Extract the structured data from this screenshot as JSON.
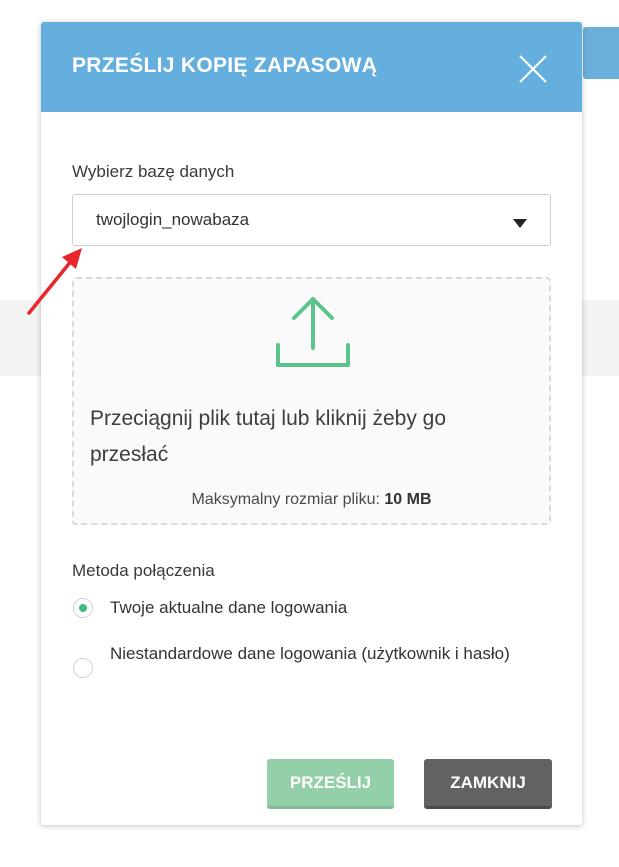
{
  "modal": {
    "title": "PRZEŚLIJ KOPIĘ ZAPASOWĄ",
    "close_icon": "close-x-icon"
  },
  "database": {
    "label": "Wybierz bazę danych",
    "selected": "twojlogin_nowabaza",
    "caret_icon": "caret-down-icon"
  },
  "upload": {
    "icon": "upload-icon",
    "text": "Przeciągnij plik tutaj lub kliknij żeby go przesłać",
    "max_size_label": "Maksymalny rozmiar pliku:",
    "max_size_value": "10 MB"
  },
  "connection": {
    "label": "Metoda połączenia",
    "options": [
      {
        "label": "Twoje aktualne dane logowania",
        "selected": true
      },
      {
        "label": "Niestandardowe dane logowania (użytkownik i hasło)",
        "selected": false
      }
    ]
  },
  "buttons": {
    "send": "PRZEŚLIJ",
    "close": "ZAMKNIJ"
  },
  "colors": {
    "header": "#64afde",
    "accent_green": "#3cbf78",
    "send_button": "#93cfa9",
    "close_button": "#626262",
    "annotation_arrow": "#e8252b"
  }
}
